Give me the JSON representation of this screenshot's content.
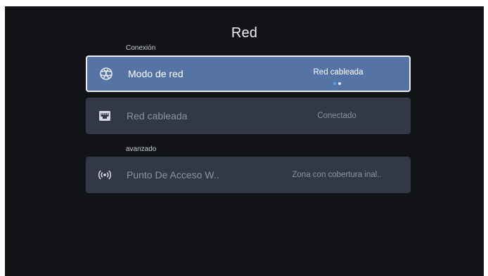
{
  "page_title": "Red",
  "sections": [
    {
      "label": "Conexión",
      "rows": [
        {
          "icon": "network-globe-icon",
          "label": "Modo de red",
          "value": "Red cableada",
          "focused": true
        },
        {
          "icon": "ethernet-port-icon",
          "label": "Red cableada",
          "value": "Conectado",
          "focused": false
        }
      ]
    },
    {
      "label": "avanzado",
      "rows": [
        {
          "icon": "wireless-hotspot-icon",
          "label": "Punto De Acceso W..",
          "value": "Zona con cobertura inal..",
          "focused": false
        }
      ]
    }
  ],
  "colors": {
    "background": "#111317",
    "row": "#323846",
    "row_focused": "#5673a6",
    "indicator_active": "#3fa8ff"
  }
}
